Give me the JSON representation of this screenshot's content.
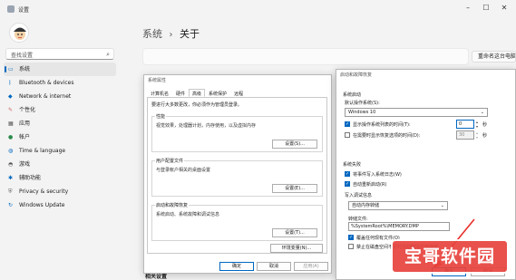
{
  "window": {
    "title": "设置"
  },
  "sidebar": {
    "search_placeholder": "查找设置",
    "items": [
      {
        "label": "系统",
        "icon": "monitor-icon"
      },
      {
        "label": "Bluetooth & devices",
        "icon": "bluetooth-icon"
      },
      {
        "label": "Network & internet",
        "icon": "wifi-icon"
      },
      {
        "label": "个性化",
        "icon": "brush-icon"
      },
      {
        "label": "应用",
        "icon": "apps-icon"
      },
      {
        "label": "帐户",
        "icon": "person-icon"
      },
      {
        "label": "Time & language",
        "icon": "globe-icon"
      },
      {
        "label": "游戏",
        "icon": "gamepad-icon"
      },
      {
        "label": "辅助功能",
        "icon": "accessibility-icon"
      },
      {
        "label": "Privacy & security",
        "icon": "shield-icon"
      },
      {
        "label": "Windows Update",
        "icon": "update-icon"
      }
    ]
  },
  "main": {
    "breadcrumb_root": "系统",
    "breadcrumb_sep": "›",
    "page_title": "关于",
    "rename_button": "重命名这台电脑",
    "related_settings": "相关设置"
  },
  "sysprops": {
    "title": "系统属性",
    "tabs": [
      "计算机名",
      "硬件",
      "高级",
      "系统保护",
      "远程"
    ],
    "admin_note": "要进行大多数更改，你必须作为管理员登录。",
    "performance": {
      "title": "性能",
      "desc": "视觉效果，处理器计划，内存使用，以及虚拟内存",
      "button": "设置(S)..."
    },
    "profiles": {
      "title": "用户配置文件",
      "desc": "与登录帐户相关的桌面设置",
      "button": "设置(E)..."
    },
    "startup": {
      "title": "启动和故障恢复",
      "desc": "系统启动、系统故障和调试信息",
      "button": "设置(T)..."
    },
    "env_button": "环境变量(N)...",
    "ok": "确定",
    "cancel": "取消",
    "apply": "应用(A)"
  },
  "recovery": {
    "title": "启动和故障恢复",
    "system_startup": "系统启动",
    "default_os_label": "默认操作系统(S):",
    "default_os_value": "Windows 10",
    "show_os_list": "显示操作系统列表的时间(T):",
    "show_os_list_value": "0",
    "show_recovery": "在需要时显示恢复选项的时间(D):",
    "show_recovery_value": "30",
    "seconds": "秒",
    "system_failure": "系统失败",
    "write_event": "将事件写入系统日志(W)",
    "auto_restart": "自动重新启动(R)",
    "write_debug": "写入调试信息",
    "debug_type": "自动内存转储",
    "dump_file_label": "转储文件:",
    "dump_file_value": "%SystemRoot%\\MEMORY.DMP",
    "overwrite": "覆盖任何现有文件(O)",
    "disable_auto_delete": "禁止在磁盘空间不足时自动删除内存转储",
    "ok": "确定",
    "cancel": "取消"
  },
  "watermark": "宝哥软件园"
}
